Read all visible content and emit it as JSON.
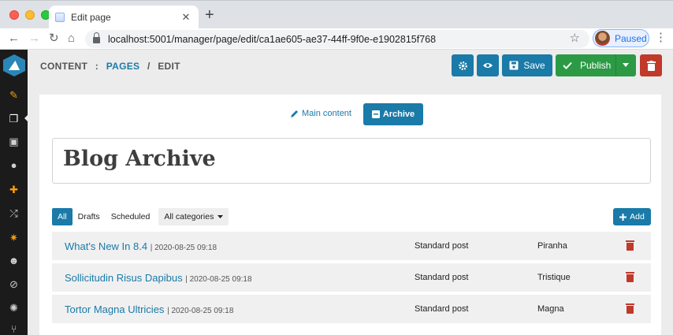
{
  "browser": {
    "tab_title": "Edit page",
    "tab_close": "✕",
    "new_tab": "+",
    "url": "localhost:5001/manager/page/edit/ca1ae605-ae37-44ff-9f0e-e1902815f768",
    "profile_status": "Paused"
  },
  "breadcrumb": {
    "section": "CONTENT",
    "separator1": ":",
    "page": "PAGES",
    "separator2": "/",
    "action": "EDIT"
  },
  "toolbar": {
    "save_label": "Save",
    "publish_label": "Publish"
  },
  "tabs": {
    "main_content": "Main content",
    "archive": "Archive"
  },
  "page_title": "Blog Archive",
  "filters": {
    "items": [
      "All",
      "Drafts",
      "Scheduled"
    ],
    "categories_label": "All categories"
  },
  "add_label": "Add",
  "posts": [
    {
      "title": "What's New In 8.4",
      "date": "| 2020-08-25 09:18",
      "type": "Standard post",
      "category": "Piranha"
    },
    {
      "title": "Sollicitudin Risus Dapibus",
      "date": "| 2020-08-25 09:18",
      "type": "Standard post",
      "category": "Tristique"
    },
    {
      "title": "Tortor Magna Ultricies",
      "date": "| 2020-08-25 09:18",
      "type": "Standard post",
      "category": "Magna"
    }
  ],
  "colors": {
    "accent": "#1a7aa8",
    "publish": "#2c9a45",
    "danger": "#c0392b",
    "sidebar": "#1b1b1b",
    "sidebar_accent": "#f39c12"
  },
  "icons": [
    "gear-icon",
    "eye-icon",
    "save-icon",
    "check-icon",
    "caret-down-icon",
    "trash-icon",
    "pen-icon",
    "archive-icon",
    "plus-icon"
  ]
}
